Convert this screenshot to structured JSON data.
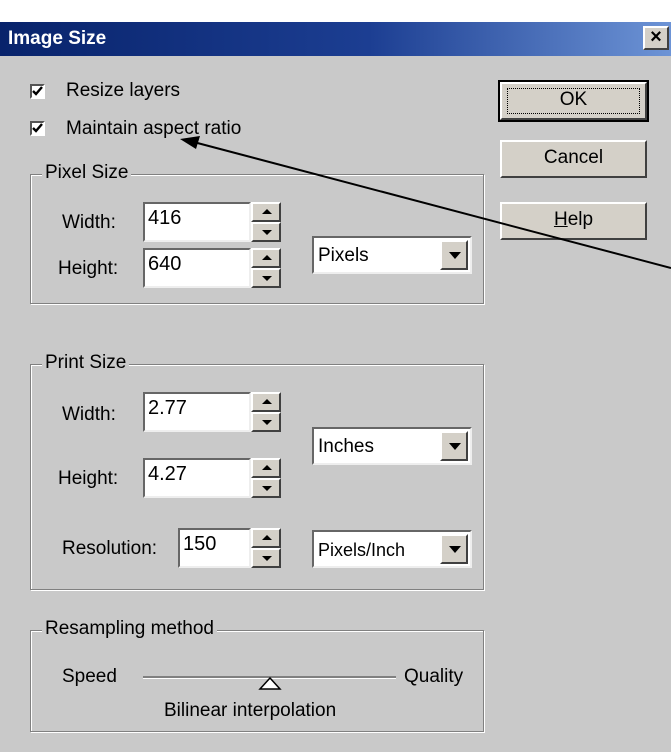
{
  "window": {
    "title": "Image Size",
    "close_label": "×"
  },
  "options": {
    "resize_layers": {
      "label": "Resize layers",
      "checked": true
    },
    "maintain_aspect": {
      "label": "Maintain aspect ratio",
      "checked": true
    }
  },
  "pixel_size": {
    "legend": "Pixel Size",
    "width_label": "Width:",
    "width_value": "416",
    "height_label": "Height:",
    "height_value": "640",
    "unit": "Pixels"
  },
  "print_size": {
    "legend": "Print Size",
    "width_label": "Width:",
    "width_value": "2.77",
    "height_label": "Height:",
    "height_value": "4.27",
    "unit": "Inches",
    "resolution_label": "Resolution:",
    "resolution_value": "150",
    "resolution_unit": "Pixels/Inch"
  },
  "resampling": {
    "legend": "Resampling method",
    "min_label": "Speed",
    "max_label": "Quality",
    "method": "Bilinear interpolation",
    "position": 0.5
  },
  "buttons": {
    "ok": "OK",
    "cancel": "Cancel",
    "help_mnemonic": "H",
    "help_rest": "elp"
  },
  "colors": {
    "title_bar": "#0a246a",
    "dialog_face": "#c9c9c9"
  }
}
